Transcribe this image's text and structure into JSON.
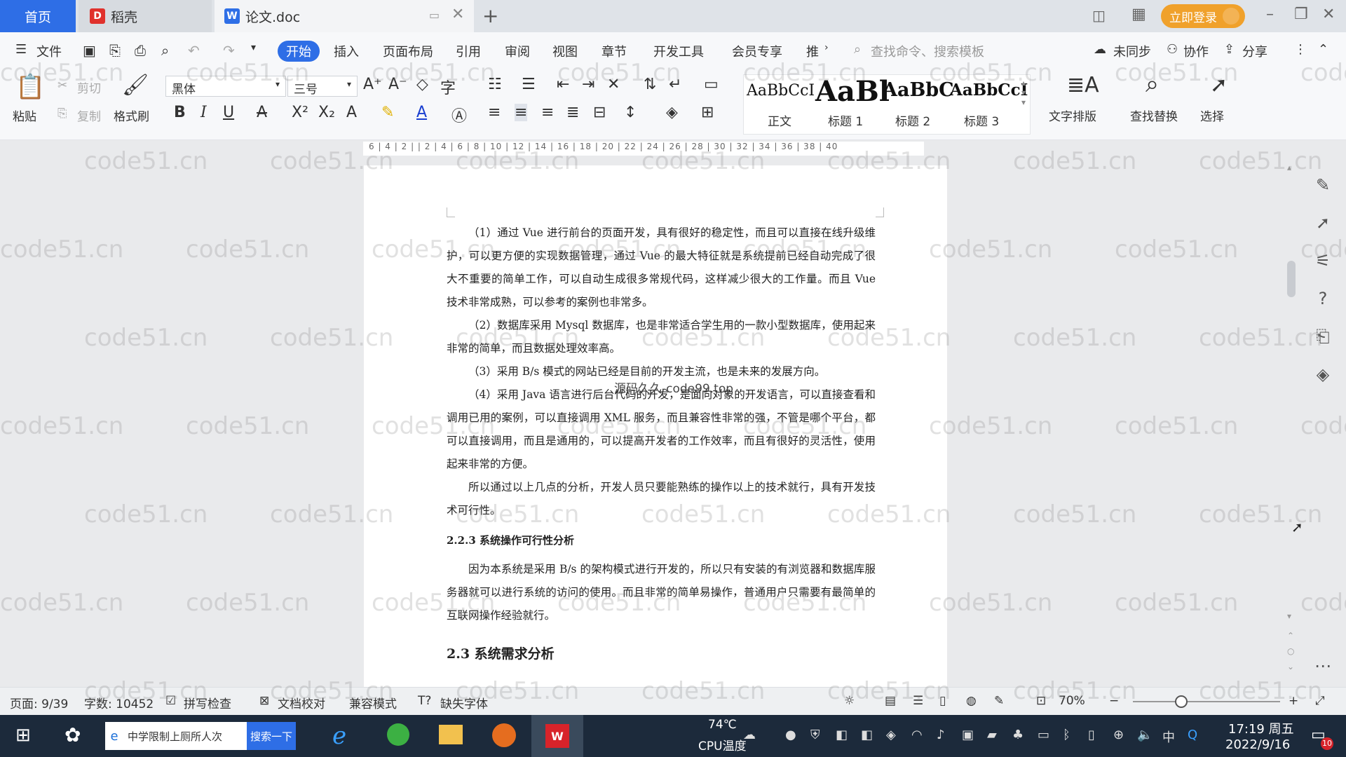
{
  "tabs": {
    "home": "首页",
    "daoke": "稻壳",
    "doc": "论文.doc",
    "login": "立即登录"
  },
  "menu": {
    "file": "文件",
    "items": [
      "开始",
      "插入",
      "页面布局",
      "引用",
      "审阅",
      "视图",
      "章节",
      "开发工具",
      "会员专享",
      "推"
    ],
    "search_cmd": "查找命令、搜索模板",
    "unsynced": "未同步",
    "collab": "协作",
    "share": "分享"
  },
  "ribbon": {
    "paste": "粘贴",
    "cut": "剪切",
    "copy": "复制",
    "format_painter": "格式刷",
    "font_name": "黑体",
    "font_size": "三号",
    "styles": [
      {
        "preview": "AaBbCcI",
        "label": "正文"
      },
      {
        "preview": "AaBl",
        "label": "标题 1"
      },
      {
        "preview": "AaBbC",
        "label": "标题 2"
      },
      {
        "preview": "AaBbCcI",
        "label": "标题 3"
      }
    ],
    "text_layout": "文字排版",
    "find_replace": "查找替换",
    "select": "选择"
  },
  "ruler": "6 | 4 | 2 |   | 2 | 4 | 6 | 8 | 10 | 12 | 14 | 16 | 18 | 20 | 22 | 24 | 26 | 28 | 30 | 32 | 34 | 36 | 38 | 40",
  "document": {
    "p1": "（1）通过 Vue 进行前台的页面开发，具有很好的稳定性，而且可以直接在线升级维护，可以更方便的实现数据管理，通过 Vue 的最大特征就是系统提前已经自动完成了很大不重要的简单工作，可以自动生成很多常规代码，这样减少很大的工作量。而且 Vue 技术非常成熟，可以参考的案例也非常多。",
    "p2": "（2）数据库采用 Mysql 数据库，也是非常适合学生用的一款小型数据库，使用起来非常的简单，而且数据处理效率高。",
    "p3": "（3）采用 B/s 模式的网站已经是目前的开发主流，也是未来的发展方向。",
    "p4": "（4）采用 Java 语言进行后台代码的开发，是面向对象的开发语言，可以直接查看和调用已用的案例，可以直接调用 XML 服务，而且兼容性非常的强，不管是哪个平台，都可以直接调用，而且是通用的，可以提高开发者的工作效率，而且有很好的灵活性，使用起来非常的方便。",
    "p5": "所以通过以上几点的分析，开发人员只要能熟练的操作以上的技术就行，具有开发技术可行性。",
    "h223": "2.2.3 系统操作可行性分析",
    "p6": "因为本系统是采用 B/s 的架构模式进行开发的，所以只有安装的有浏览器和数据库服务器就可以进行系统的访问的使用。而且非常的简单易操作，普通用户只需要有最简单的互联网操作经验就行。",
    "h23": "2.3 系统需求分析",
    "overlay": "源码久久-code99.top"
  },
  "status": {
    "page": "页面: 9/39",
    "words": "字数: 10452",
    "spell": "拼写检查",
    "proof": "文档校对",
    "compat": "兼容模式",
    "missing_font": "缺失字体",
    "zoom": "70%"
  },
  "taskbar": {
    "search_text": "中学限制上厕所人次",
    "search_btn": "搜索一下",
    "temp": "74℃",
    "temp_label": "CPU温度",
    "ime": "中",
    "time": "17:19 周五",
    "date": "2022/9/16",
    "badge": "10"
  },
  "watermark": "code51.cn",
  "colors": {
    "accent": "#2e6ee6",
    "login": "#f0a12b",
    "taskbar": "#1c2a3b"
  }
}
